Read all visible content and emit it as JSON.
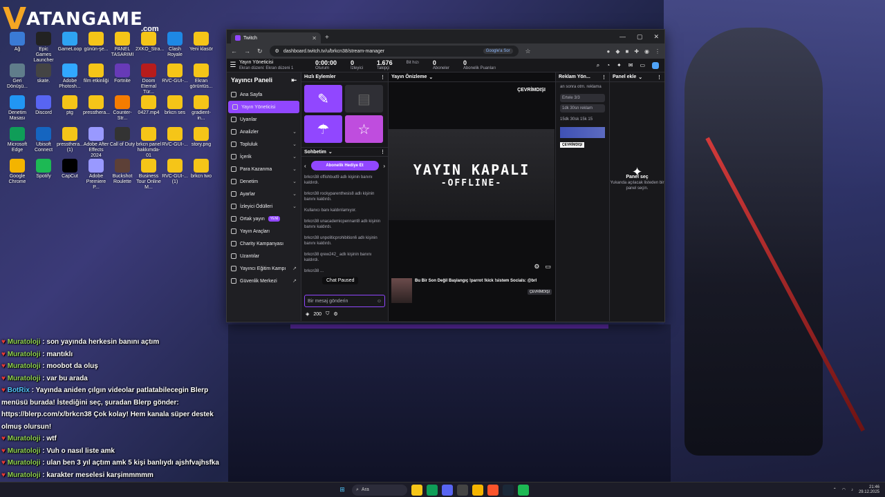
{
  "logo": {
    "v": "V",
    "text": "ATANGAME",
    "com": ".com"
  },
  "desktop_icons": [
    {
      "label": "Ağ",
      "color": "#3a7bd5"
    },
    {
      "label": "Epic Games Launcher",
      "color": "#222"
    },
    {
      "label": "GameLoop",
      "color": "#2ea3f2"
    },
    {
      "label": "günün-şe...",
      "color": "#f5c518"
    },
    {
      "label": "PANEL TASARIMI",
      "color": "#f5c518"
    },
    {
      "label": "2XKO_Stra...",
      "color": "#f5c518"
    },
    {
      "label": "Clash Royale",
      "color": "#1e88e5"
    },
    {
      "label": "Yeni klasör",
      "color": "#f5c518"
    },
    {
      "label": "Geri Dönüşü...",
      "color": "#607d8b"
    },
    {
      "label": "skate.",
      "color": "#444"
    },
    {
      "label": "Adobe Photosh...",
      "color": "#31a8ff"
    },
    {
      "label": "film etkinliği",
      "color": "#f5c518"
    },
    {
      "label": "Fortnite",
      "color": "#673ab7"
    },
    {
      "label": "Doom Eternal Tür...",
      "color": "#b71c1c"
    },
    {
      "label": "RVC-GUI-...",
      "color": "#f5c518"
    },
    {
      "label": "Ekran görüntüs...",
      "color": "#f5c518"
    },
    {
      "label": "Denetim Masası",
      "color": "#2196f3"
    },
    {
      "label": "Discord",
      "color": "#5865f2"
    },
    {
      "label": "ptg",
      "color": "#f5c518"
    },
    {
      "label": "presstheга...",
      "color": "#f5c518"
    },
    {
      "label": "Counter-Str...",
      "color": "#f57c00"
    },
    {
      "label": "0427.mp4",
      "color": "#f5c518"
    },
    {
      "label": "brkcn ses",
      "color": "#f5c518"
    },
    {
      "label": "gradient-in...",
      "color": "#f5c518"
    },
    {
      "label": "Microsoft Edge",
      "color": "#0f9d58"
    },
    {
      "label": "Ubisoft Connect",
      "color": "#1565c0"
    },
    {
      "label": "presstheга... (1)",
      "color": "#f5c518"
    },
    {
      "label": "Adobe After Effects 2024",
      "color": "#9999ff"
    },
    {
      "label": "Call of Duty",
      "color": "#333"
    },
    {
      "label": "brkcn panel hakkımda-01",
      "color": "#f5c518"
    },
    {
      "label": "RVC-GUI-...",
      "color": "#f5c518"
    },
    {
      "label": "story.png",
      "color": "#f5c518"
    },
    {
      "label": "Google Chrome",
      "color": "#f4b400"
    },
    {
      "label": "Spotify",
      "color": "#1db954"
    },
    {
      "label": "CapCut",
      "color": "#000"
    },
    {
      "label": "Adobe Premiere P...",
      "color": "#9999ff"
    },
    {
      "label": "Buckshot Roulette",
      "color": "#5d4037"
    },
    {
      "label": "Business Tour Online M...",
      "color": "#f5c518"
    },
    {
      "label": "RVC-GUI-... (1)",
      "color": "#f5c518"
    },
    {
      "label": "brkcn two",
      "color": "#f5c518"
    }
  ],
  "browser": {
    "tab_title": "Twitch",
    "url": "dashboard.twitch.tv/u/brkcn38/stream-manager",
    "lens_label": "Google'a Sor"
  },
  "twitch": {
    "mode_title": "Yayın Yöneticisi",
    "mode_sub": "Ekran düzeni: Ekran düzeni 1",
    "stats": [
      {
        "value": "0:00:00",
        "label": "Oturum"
      },
      {
        "value": "0",
        "label": "İzleyici"
      },
      {
        "value": "1.676",
        "label": "Takipçi"
      },
      {
        "value": "",
        "label": "Bit hızı"
      },
      {
        "value": "0",
        "label": "Aboneler"
      },
      {
        "value": "0",
        "label": "Abonelik Puanları"
      }
    ],
    "sidebar_title": "Yayıncı Paneli",
    "sidebar": [
      {
        "label": "Ana Sayfa",
        "chev": ""
      },
      {
        "label": "Yayın Yöneticisi",
        "chev": "",
        "active": true
      },
      {
        "label": "Uyarılar",
        "chev": ""
      },
      {
        "label": "Analizler",
        "chev": "⌄"
      },
      {
        "label": "Topluluk",
        "chev": "⌄"
      },
      {
        "label": "İçerik",
        "chev": "⌄"
      },
      {
        "label": "Para Kazanma",
        "chev": "⌄"
      },
      {
        "label": "Denetim",
        "chev": "⌄"
      },
      {
        "label": "Ayarlar",
        "chev": "⌄"
      },
      {
        "label": "İzleyici Ödülleri",
        "chev": "⌄"
      },
      {
        "label": "Ortak yayın",
        "badge": "YENİ"
      },
      {
        "label": "Yayın Araçları",
        "chev": ""
      },
      {
        "label": "Charity Kampanyası",
        "chev": ""
      },
      {
        "label": "Uzantılar",
        "chev": ""
      },
      {
        "label": "Yayıncı Eğitim Kampı",
        "chev": "↗"
      },
      {
        "label": "Güvenlik Merkezi",
        "chev": "↗"
      }
    ],
    "quick_actions_title": "Hızlı Eylemler",
    "chat_title": "Sohbetim",
    "gift_label": "Abonelik Hediye Et",
    "chat_messages": [
      "brkcn38 offishbud9 adlı kişinin banını kaldırdı.",
      "brkcn38 rockyparenthesis8 adlı kişinin banını kaldırdı.",
      "Kullanıcı banı kaldırılamıyor.",
      "brkcn38 unacademicpennant8 adlı kişinin banını kaldırdı.",
      "brkcn38 unpoliticprohibition6 adlı kişinin banını kaldırdı.",
      "brkcn38 qrew242_ adlı kişinin banını kaldırdı.",
      "brkcn38 ..."
    ],
    "chat_paused": "Chat Paused",
    "chat_placeholder": "Bir mesaj gönderin",
    "chat_points": "200",
    "preview_title": "Yayın Önizleme",
    "offline_badge": "ÇEVRİMDIŞI",
    "offline_big": "YAYIN KAPALI",
    "offline_small": "-OFFLINE-",
    "stream_title": "Bu Bir Son Değil Başlangıç !parrot !kick !sistem Socials: @brl",
    "stream_tag": "ÇEVRİMDIŞI",
    "ads_title": "Reklam Yön...",
    "ads_line1": "an sonra otm. reklama",
    "ads_snooze": "Ertele 3/3",
    "ads_next": "1dk 30sn reklam",
    "ads_times": "15dk 30sk 15k 15",
    "ads_offline": "ÇEVRİMDIŞI",
    "panel_title": "Panel ekle",
    "panel_select": "Panel seç",
    "panel_hint": "Yukarıda açılacak listeden bir panel seçin."
  },
  "overlay_chat": [
    {
      "user": "Muratoloji",
      "msg": " : son yayında herkesin banını açtım"
    },
    {
      "user": "Muratoloji",
      "msg": " : mantıklı"
    },
    {
      "user": "Muratoloji",
      "msg": " : moobot da oluş"
    },
    {
      "user": "Muratoloji",
      "msg": " : var bu arada"
    },
    {
      "user": "BotRix",
      "msg": " : Yayında aniden çılgın videolar patlatabilecegin Blerp menüsü burada! İstediğini seç, şuradan Blerp gönder: https://blerp.com/x/brkcn38 Çok kolay! Hem kanala süper destek olmuş olursun!",
      "bot": true
    },
    {
      "user": "Muratoloji",
      "msg": " : wtf"
    },
    {
      "user": "Muratoloji",
      "msg": " : Vuh o nasıl liste amk"
    },
    {
      "user": "Muratoloji",
      "msg": " : ulan ben 3 yıl açtım amk 5 kişi banlıydı ajshfvajhsfka"
    },
    {
      "user": "Muratoloji",
      "msg": " : karakter meselesi karşimmmmm"
    }
  ],
  "taskbar": {
    "search_label": "Ara",
    "time": "21:46",
    "date": "29.12.2025"
  }
}
